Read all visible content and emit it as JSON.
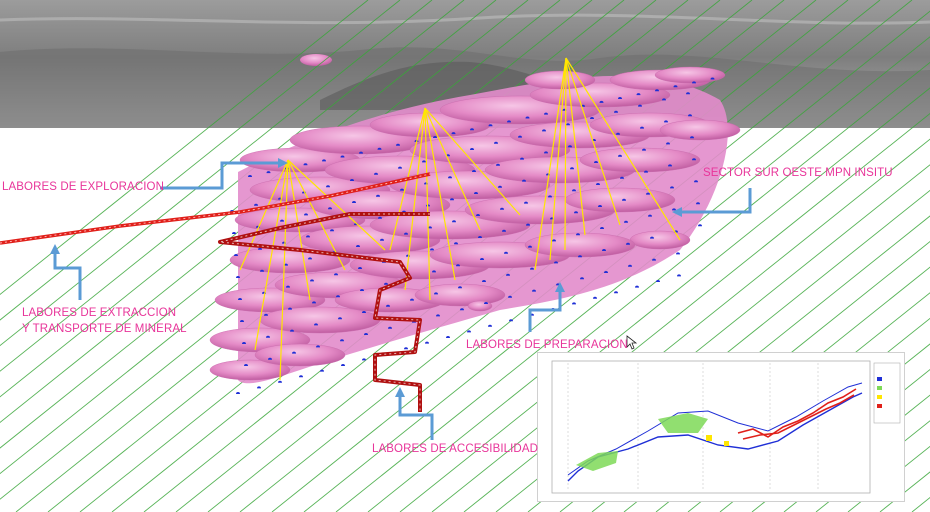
{
  "labels": {
    "exploracion": "LABORES DE EXPLORACION",
    "extraccion_1": "LABORES DE EXTRACCION",
    "extraccion_2": "Y TRANSPORTE DE MINERAL",
    "preparacion": "LABORES DE PREPARACION",
    "accesibilidad": "LABORES DE ACCESIBILIDAD",
    "sector": "SECTOR SUR OESTE MPN INSITU"
  },
  "colors": {
    "label_text": "#e8359a",
    "arrow": "#5b9bd5",
    "orebody": "#e07fc0",
    "grid_line": "#3aa63a",
    "drill_point": "#1f2fd6",
    "fan_line": "#ffe600",
    "transport_tunnel": "#e0201a",
    "access_ramp": "#b01010",
    "terrain": "#8c8c8c"
  },
  "icons": {
    "cursor": "mouse-pointer-icon"
  }
}
